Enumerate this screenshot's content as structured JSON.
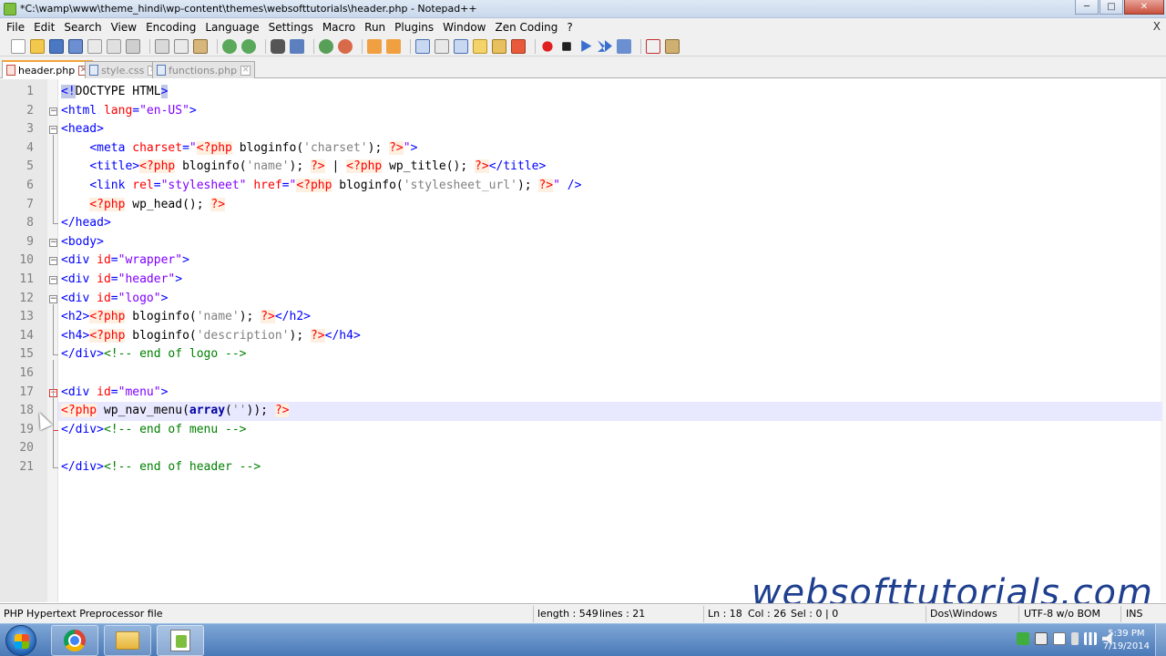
{
  "window": {
    "title": "*C:\\wamp\\www\\theme_hindi\\wp-content\\themes\\websofttutorials\\header.php - Notepad++",
    "buttons": [
      "minimize",
      "maximize",
      "close"
    ]
  },
  "menu": {
    "items": [
      "File",
      "Edit",
      "Search",
      "View",
      "Encoding",
      "Language",
      "Settings",
      "Macro",
      "Run",
      "Plugins",
      "Window",
      "Zen Coding",
      "?"
    ],
    "close_label": "X"
  },
  "tabs": [
    {
      "label": "header.php",
      "active": true
    },
    {
      "label": "style.css",
      "active": false
    },
    {
      "label": "functions.php",
      "active": false
    }
  ],
  "editor": {
    "current_line": 18,
    "lines": [
      "<!DOCTYPE HTML>",
      "<html lang=\"en-US\">",
      "<head>",
      "    <meta charset=\"<?php bloginfo('charset'); ?>\">",
      "    <title><?php bloginfo('name'); ?> | <?php wp_title(); ?></title>",
      "    <link rel=\"stylesheet\" href=\"<?php bloginfo('stylesheet_url'); ?>\" />",
      "    <?php wp_head(); ?>",
      "</head>",
      "<body>",
      "<div id=\"wrapper\">",
      "<div id=\"header\">",
      "<div id=\"logo\">",
      "<h2><?php bloginfo('name'); ?></h2>",
      "<h4><?php bloginfo('description'); ?></h4>",
      "</div><!-- end of logo -->",
      "",
      "<div id=\"menu\">",
      "<?php wp_nav_menu(array('')); ?>",
      "</div><!-- end of menu -->",
      "",
      "</div><!-- end of header -->"
    ]
  },
  "watermark": "websofttutorials.com",
  "status": {
    "file_type": "PHP Hypertext Preprocessor file",
    "length": "length : 549",
    "lines": "lines : 21",
    "ln": "Ln : 18",
    "col": "Col : 26",
    "sel": "Sel : 0 | 0",
    "eol": "Dos\\Windows",
    "encoding": "UTF-8 w/o BOM",
    "mode": "INS"
  },
  "taskbar": {
    "apps": [
      "chrome-icon",
      "folder-icon",
      "notepadpp-icon"
    ],
    "time": "5:39 PM",
    "date": "7/19/2014"
  }
}
